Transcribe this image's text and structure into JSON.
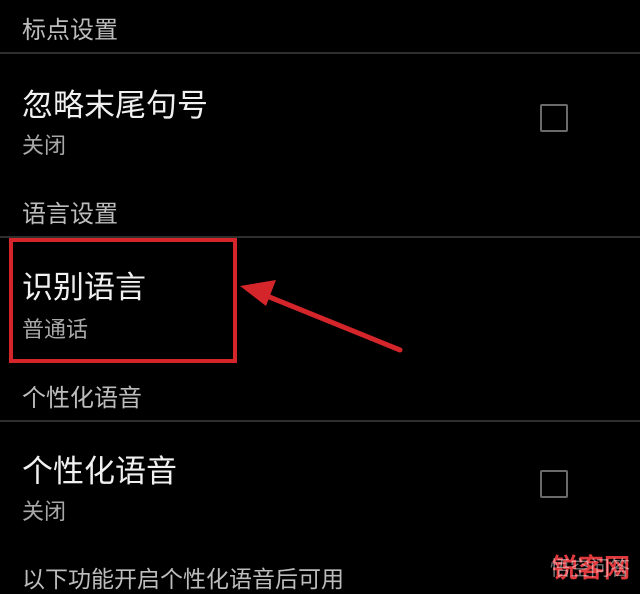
{
  "sections": {
    "punctuation": {
      "header": "标点设置",
      "ignore_trailing_period": {
        "title": "忽略末尾句号",
        "summary": "关闭",
        "checked": false
      }
    },
    "language": {
      "header": "语言设置",
      "recognition_language": {
        "title": "识别语言",
        "summary": "普通话"
      }
    },
    "personalized_voice": {
      "header": "个性化语音",
      "personalized_voice_toggle": {
        "title": "个性化语音",
        "summary": "关闭",
        "checked": false
      },
      "footer_note": "以下功能开启个性化语音后可用"
    }
  },
  "annotation": {
    "highlight_color": "#d4252a"
  },
  "watermark": {
    "brand_red": "锐客",
    "brand_rest": "网",
    "overlay": "悟空问答"
  }
}
